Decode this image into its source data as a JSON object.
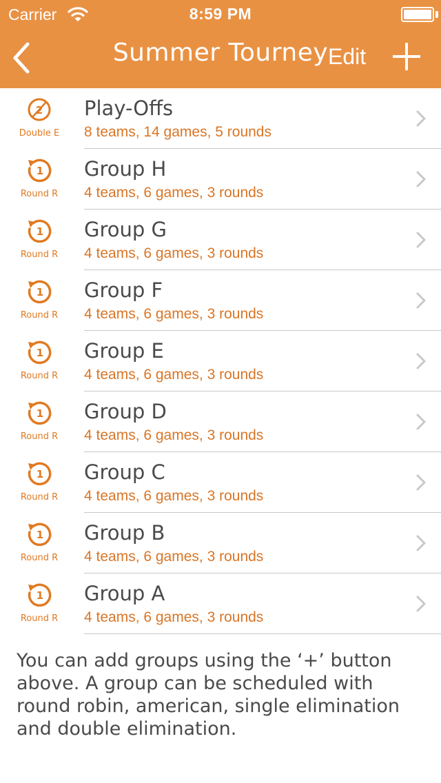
{
  "status_bar": {
    "carrier": "Carrier",
    "time": "8:59 PM"
  },
  "nav": {
    "title": "Summer Tourney",
    "edit_label": "Edit"
  },
  "colors": {
    "accent": "#E99143",
    "subtitle": "#D97525",
    "text": "#4a4a4a"
  },
  "groups": [
    {
      "icon": "double-elimination-icon",
      "glyph": "2",
      "badge": "Double E",
      "title": "Play-Offs",
      "subtitle": "8 teams, 14 games, 5 rounds"
    },
    {
      "icon": "round-robin-icon",
      "glyph": "1",
      "badge": "Round R",
      "title": "Group H",
      "subtitle": "4 teams, 6 games, 3 rounds"
    },
    {
      "icon": "round-robin-icon",
      "glyph": "1",
      "badge": "Round R",
      "title": "Group G",
      "subtitle": "4 teams, 6 games, 3 rounds"
    },
    {
      "icon": "round-robin-icon",
      "glyph": "1",
      "badge": "Round R",
      "title": "Group F",
      "subtitle": "4 teams, 6 games, 3 rounds"
    },
    {
      "icon": "round-robin-icon",
      "glyph": "1",
      "badge": "Round R",
      "title": "Group E",
      "subtitle": "4 teams, 6 games, 3 rounds"
    },
    {
      "icon": "round-robin-icon",
      "glyph": "1",
      "badge": "Round R",
      "title": "Group D",
      "subtitle": "4 teams, 6 games, 3 rounds"
    },
    {
      "icon": "round-robin-icon",
      "glyph": "1",
      "badge": "Round R",
      "title": "Group C",
      "subtitle": "4 teams, 6 games, 3 rounds"
    },
    {
      "icon": "round-robin-icon",
      "glyph": "1",
      "badge": "Round R",
      "title": "Group B",
      "subtitle": "4 teams, 6 games, 3 rounds"
    },
    {
      "icon": "round-robin-icon",
      "glyph": "1",
      "badge": "Round R",
      "title": "Group A",
      "subtitle": "4 teams, 6 games, 3 rounds"
    }
  ],
  "footer_text": "You can add groups using the ‘+’ button above. A group can be scheduled with round robin, american, single elimination and double elimination."
}
